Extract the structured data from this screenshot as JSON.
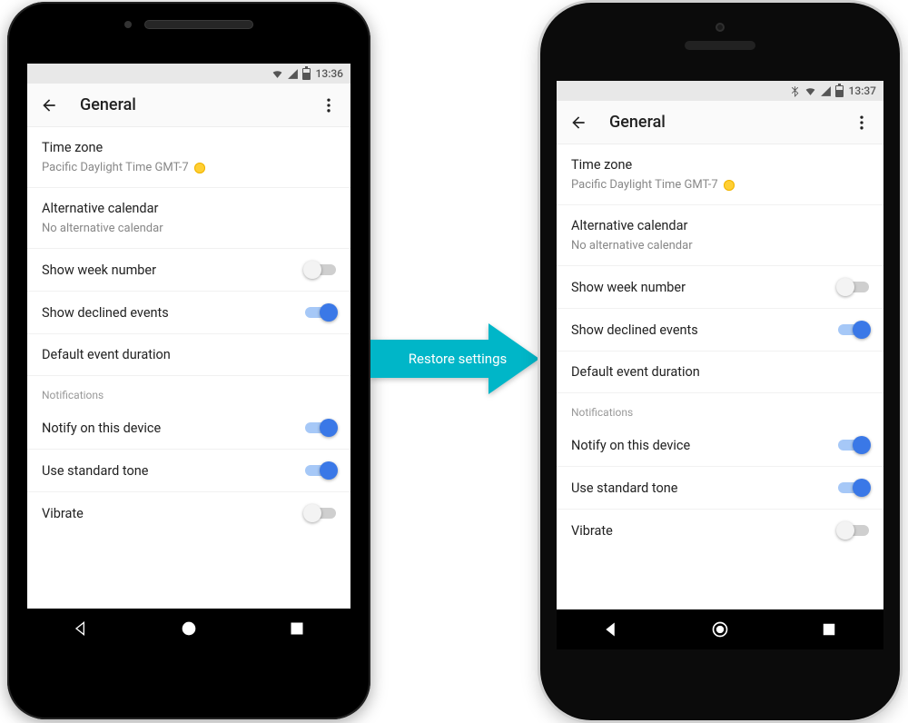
{
  "arrow_label": "Restore settings",
  "colors": {
    "accent": "#3a78e7",
    "arrow": "#00b6c8"
  },
  "phones": [
    {
      "id": "a",
      "status": {
        "bluetooth": false,
        "clock": "13:36"
      },
      "appbar": {
        "title": "General"
      },
      "rows": {
        "timezone_label": "Time zone",
        "timezone_value": "Pacific Daylight Time  GMT-7",
        "altcal_label": "Alternative calendar",
        "altcal_value": "No alternative calendar",
        "week_number": "Show week number",
        "declined": "Show declined events",
        "default_duration": "Default event duration",
        "section_notifications": "Notifications",
        "notify_device": "Notify on this device",
        "standard_tone": "Use standard tone",
        "vibrate": "Vibrate"
      },
      "toggles": {
        "week_number": false,
        "declined": true,
        "notify_device": true,
        "standard_tone": true,
        "vibrate": false
      }
    },
    {
      "id": "b",
      "status": {
        "bluetooth": true,
        "clock": "13:37"
      },
      "appbar": {
        "title": "General"
      },
      "rows": {
        "timezone_label": "Time zone",
        "timezone_value": "Pacific Daylight Time  GMT-7",
        "altcal_label": "Alternative calendar",
        "altcal_value": "No alternative calendar",
        "week_number": "Show week number",
        "declined": "Show declined events",
        "default_duration": "Default event duration",
        "section_notifications": "Notifications",
        "notify_device": "Notify on this device",
        "standard_tone": "Use standard tone",
        "vibrate": "Vibrate"
      },
      "toggles": {
        "week_number": false,
        "declined": true,
        "notify_device": true,
        "standard_tone": true,
        "vibrate": false
      }
    }
  ]
}
